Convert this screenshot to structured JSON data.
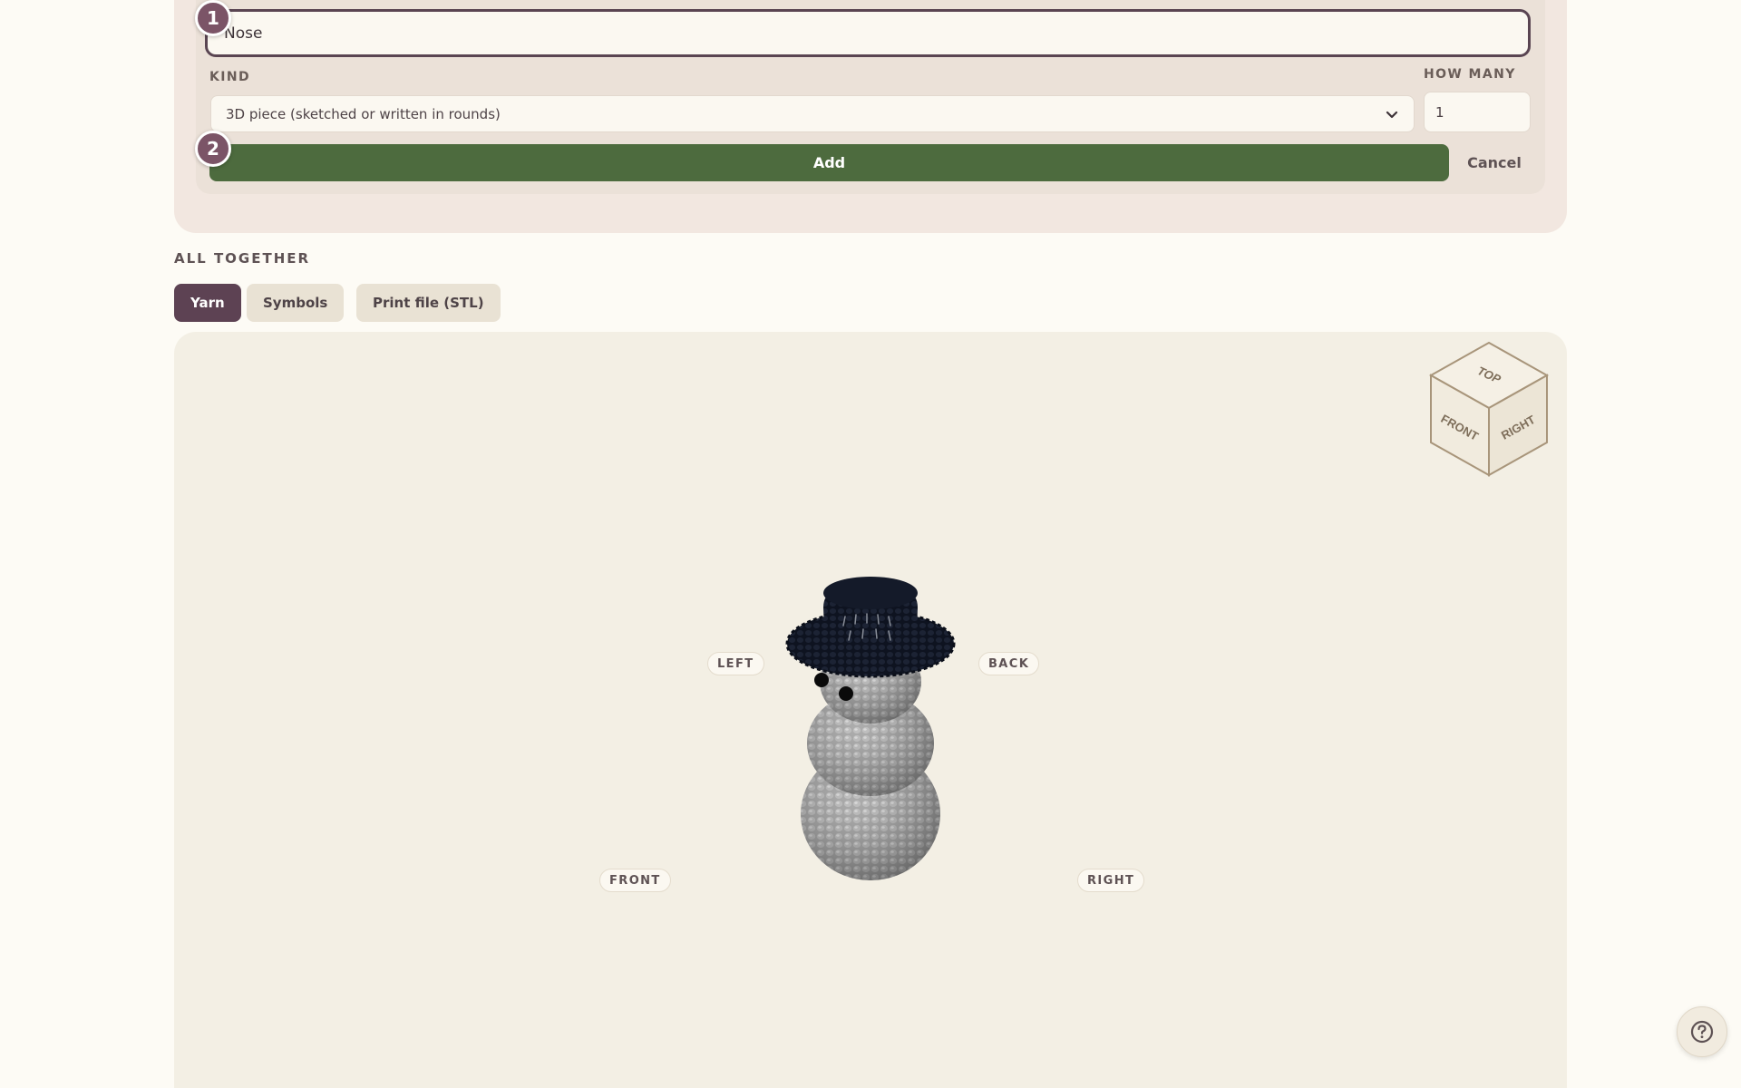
{
  "form": {
    "name_value": "Nose",
    "kind_label": "KIND",
    "kind_value": "3D piece (sketched or written in rounds)",
    "quantity_label": "HOW MANY",
    "quantity_value": "1",
    "add_label": "Add",
    "cancel_label": "Cancel",
    "steps": [
      "1",
      "2"
    ]
  },
  "all_together": {
    "title": "ALL TOGETHER",
    "tabs": [
      {
        "label": "Yarn",
        "active": true
      },
      {
        "label": "Symbols",
        "active": false
      },
      {
        "label": "Print file (STL)",
        "active": false
      }
    ],
    "view_labels": {
      "left": "LEFT",
      "back": "BACK",
      "front": "FRONT",
      "right": "RIGHT"
    },
    "cube_faces": {
      "top": "TOP",
      "front": "FRONT",
      "right": "RIGHT"
    }
  },
  "icons": {
    "select": "chevron-down-icon",
    "help": "question-circle-icon"
  },
  "colors": {
    "accent_primary": "#5d4253",
    "add_button": "#4d6b3e",
    "step_badge": "#7b5467",
    "page_background": "#fdfbf5",
    "viewer_background": "#f3efe4"
  }
}
